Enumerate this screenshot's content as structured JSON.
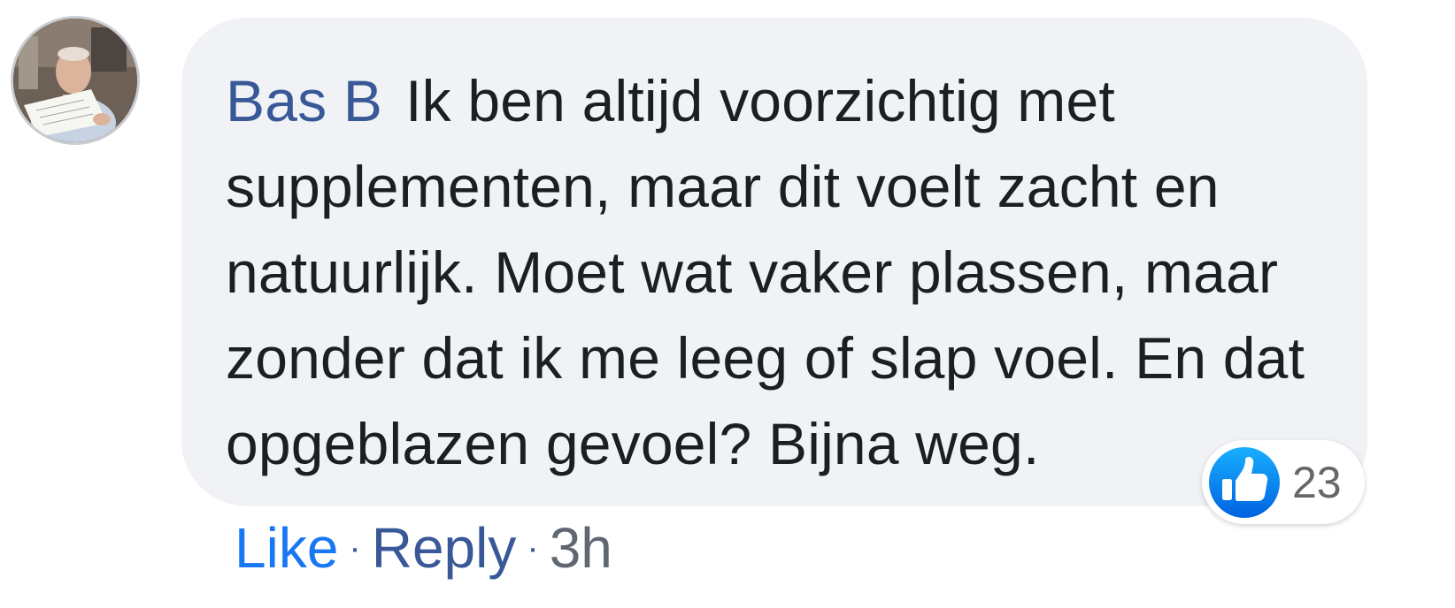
{
  "comment": {
    "author": "Bas B",
    "text": "Ik ben altijd voorzichtig met supplementen, maar dit voelt zacht en natuurlijk. Moet wat vaker plassen, maar zonder dat ik me leeg of slap voel. En dat opgeblazen gevoel? Bijna weg.",
    "avatar_icon": "profile-photo"
  },
  "reactions": {
    "icon": "thumbs-up-icon",
    "count": "23",
    "color": "#1877f2"
  },
  "actions": {
    "like_label": "Like",
    "separator": "·",
    "reply_label": "Reply",
    "timestamp": "3h"
  },
  "colors": {
    "bubble": "#f0f2f5",
    "author": "#385898",
    "text": "#1c1e21",
    "like": "#1877f2",
    "meta": "#606770"
  }
}
